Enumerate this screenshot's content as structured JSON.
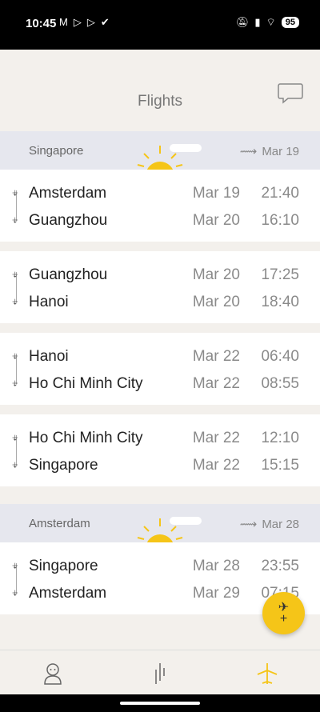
{
  "status_bar": {
    "time": "10:45",
    "battery": "95"
  },
  "header": {
    "title": "Flights"
  },
  "groups": [
    {
      "city": "Singapore",
      "date": "Mar 19",
      "flights": [
        {
          "from_city": "Amsterdam",
          "from_date": "Mar 19",
          "from_time": "21:40",
          "to_city": "Guangzhou",
          "to_date": "Mar 20",
          "to_time": "16:10"
        },
        {
          "from_city": "Guangzhou",
          "from_date": "Mar 20",
          "from_time": "17:25",
          "to_city": "Hanoi",
          "to_date": "Mar 20",
          "to_time": "18:40"
        },
        {
          "from_city": "Hanoi",
          "from_date": "Mar 22",
          "from_time": "06:40",
          "to_city": "Ho Chi Minh City",
          "to_date": "Mar 22",
          "to_time": "08:55"
        },
        {
          "from_city": "Ho Chi Minh City",
          "from_date": "Mar 22",
          "from_time": "12:10",
          "to_city": "Singapore",
          "to_date": "Mar 22",
          "to_time": "15:15"
        }
      ]
    },
    {
      "city": "Amsterdam",
      "date": "Mar 28",
      "flights": [
        {
          "from_city": "Singapore",
          "from_date": "Mar 28",
          "from_time": "23:55",
          "to_city": "Amsterdam",
          "to_date": "Mar 29",
          "to_time": "07:15"
        }
      ]
    }
  ],
  "fab": {
    "label": "+"
  },
  "colors": {
    "accent": "#f5c518",
    "group_bg": "#e6e7ee",
    "card_bg": "#ffffff"
  },
  "nav": {
    "items": [
      {
        "icon": "profile-icon"
      },
      {
        "icon": "stats-icon"
      },
      {
        "icon": "airplane-icon"
      }
    ]
  }
}
